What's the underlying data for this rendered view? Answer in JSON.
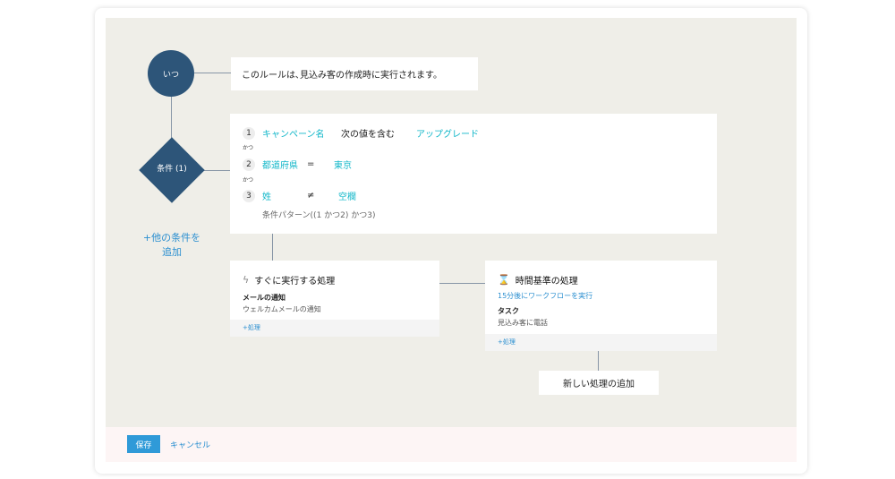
{
  "when": {
    "node_label": "いつ",
    "text": "このルールは､見込み客の作成時に実行されます。"
  },
  "condition_node": {
    "label": "条件 (1)"
  },
  "add_condition": {
    "line1": "+他の条件を",
    "line2": "追加"
  },
  "conditions": {
    "rows": [
      {
        "num": "1",
        "field": "キャンペーン名",
        "op": "次の値を含む",
        "value": "アップグレード"
      },
      {
        "num": "2",
        "field": "都道府県",
        "op": "=",
        "value": "東京"
      },
      {
        "num": "3",
        "field": "姓",
        "op": "≠",
        "value": "空欄"
      }
    ],
    "connector": "かつ",
    "pattern": "条件パターン((1 かつ2) かつ3)"
  },
  "immediate_action": {
    "title": "すぐに実行する処理",
    "icon": "lightning-icon",
    "item_title": "メールの通知",
    "item_desc": "ウェルカムメールの通知",
    "add_label": "+処理"
  },
  "time_action": {
    "title": "時間基準の処理",
    "icon": "hourglass-icon",
    "schedule": "15分後にワークフローを実行",
    "item_title": "タスク",
    "item_desc": "見込み客に電話",
    "add_label": "+処理"
  },
  "new_action": {
    "label": "新しい処理の追加"
  },
  "footer": {
    "save_label": "保存",
    "cancel_label": "キャンセル"
  },
  "colors": {
    "node": "#2d5579",
    "teal": "#12b7c9",
    "link": "#2b8fd0",
    "button": "#2f9ad8"
  }
}
